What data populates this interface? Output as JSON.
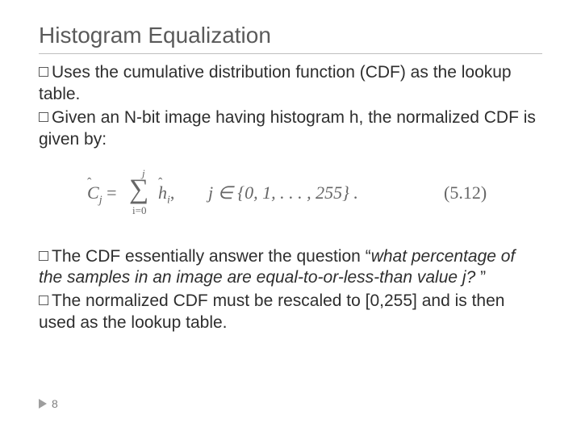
{
  "title": "Histogram Equalization",
  "bullets": {
    "b1_lead": "Uses",
    "b1_rest": " the cumulative distribution function (CDF) as the lookup table.",
    "b2_lead": "Given",
    "b2_rest": " an N-bit image having histogram h, the normalized CDF is given by:",
    "b3_lead": "The",
    "b3_rest_a": " CDF essentially answer the question ",
    "b3_quote_open": "“",
    "b3_italic": "what percentage of the samples in an image are equal-to-or-less-than value j? ",
    "b3_quote_close": "”",
    "b4_lead": "The",
    "b4_rest": " normalized CDF must be rescaled to [0,255] and is then used as the lookup table."
  },
  "equation": {
    "lhs_hat": "ˆ",
    "lhs": "C",
    "lhs_sub": "j",
    "equals": " = ",
    "sum": "∑",
    "sum_upper": "j",
    "sum_lower": "i=0",
    "rhs_hat": "ˆ",
    "rhs": "h",
    "rhs_sub": "i",
    "comma": ",",
    "set": "j ∈ {0, 1, . . . , 255} .",
    "number": "(5.12)"
  },
  "page_number": "8"
}
